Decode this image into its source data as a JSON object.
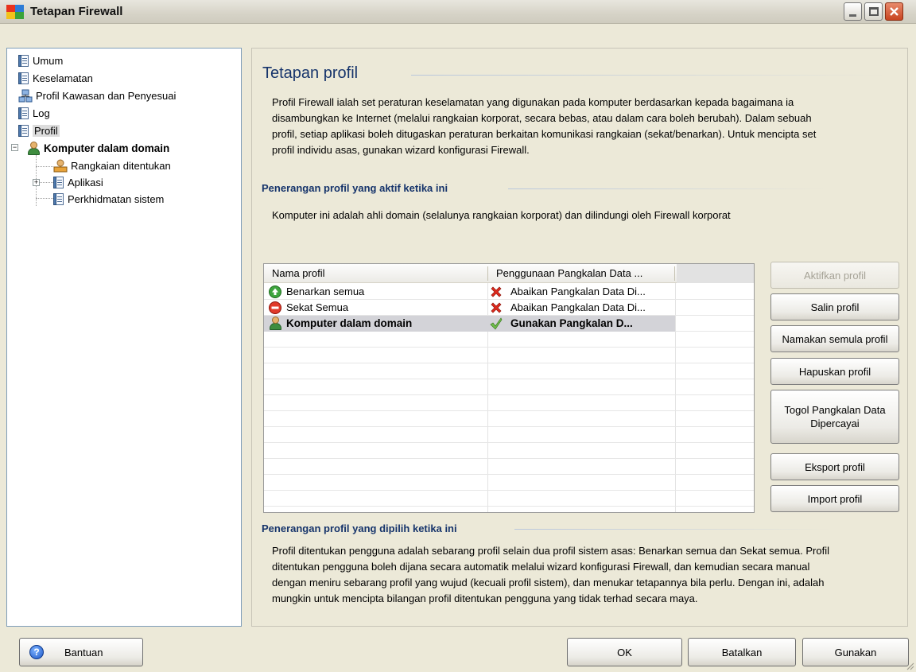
{
  "window": {
    "title": "Tetapan Firewall"
  },
  "tree": {
    "items": [
      {
        "label": "Umum",
        "icon": "document-icon"
      },
      {
        "label": "Keselamatan",
        "icon": "document-icon"
      },
      {
        "label": "Profil Kawasan dan Penyesuai",
        "icon": "network-icon"
      },
      {
        "label": "Log",
        "icon": "document-icon"
      },
      {
        "label": "Profil",
        "icon": "document-icon",
        "selected": true
      },
      {
        "label": "Komputer dalam domain",
        "icon": "user-icon",
        "expanded": true
      },
      {
        "label": "Rangkaian ditentukan",
        "icon": "network-icon"
      },
      {
        "label": "Aplikasi",
        "icon": "document-icon",
        "expander": "+"
      },
      {
        "label": "Perkhidmatan sistem",
        "icon": "document-icon"
      }
    ]
  },
  "main": {
    "title": "Tetapan profil",
    "intro": [
      "Profil Firewall ialah set peraturan keselamatan yang digunakan pada komputer berdasarkan kepada bagaimana ia",
      "disambungkan ke Internet (melalui rangkaian korporat, secara bebas, atau dalam cara boleh berubah). Dalam sebuah",
      "profil, setiap aplikasi boleh ditugaskan peraturan berkaitan komunikasi rangkaian (sekat/benarkan). Untuk mencipta set",
      "profil individu asas, gunakan wizard konfigurasi Firewall."
    ],
    "active_heading": "Penerangan profil yang aktif ketika ini",
    "active_text": "Komputer ini adalah ahli domain (selalunya rangkaian korporat) dan dilindungi oleh  Firewall korporat",
    "table": {
      "columns": [
        "Nama profil",
        "Penggunaan Pangkalan Data ..."
      ],
      "rows": [
        {
          "name": "Benarkan semua",
          "name_icon": "allow-icon",
          "db": "Abaikan Pangkalan Data Di...",
          "db_icon": "red-x-icon",
          "selected": false
        },
        {
          "name": "Sekat Semua",
          "name_icon": "block-icon",
          "db": "Abaikan Pangkalan Data Di...",
          "db_icon": "red-x-icon",
          "selected": false
        },
        {
          "name": "Komputer dalam domain",
          "name_icon": "user-icon",
          "db": "Gunakan Pangkalan D...",
          "db_icon": "green-check-icon",
          "selected": true
        }
      ]
    },
    "buttons": {
      "activate": "Aktifkan profil",
      "copy": "Salin profil",
      "rename": "Namakan semula profil",
      "delete": "Hapuskan profil",
      "toggle_line1": "Togol Pangkalan Data",
      "toggle_line2": "Dipercayai",
      "export": "Eksport profil",
      "import": "Import profil"
    },
    "selected_heading": "Penerangan profil yang dipilih ketika ini",
    "selected_text": [
      "Profil ditentukan pengguna adalah sebarang profil selain dua profil sistem asas: Benarkan semua dan Sekat semua. Profil",
      "ditentukan pengguna boleh dijana secara automatik melalui wizard konfigurasi Firewall, dan kemudian secara manual",
      "dengan meniru sebarang profil yang wujud (kecuali profil sistem), dan menukar tetapannya bila perlu. Dengan ini, adalah",
      "mungkin untuk mencipta bilangan profil ditentukan pengguna yang tidak terhad secara maya."
    ]
  },
  "footer": {
    "help": "Bantuan",
    "ok": "OK",
    "cancel": "Batalkan",
    "apply": "Gunakan"
  }
}
